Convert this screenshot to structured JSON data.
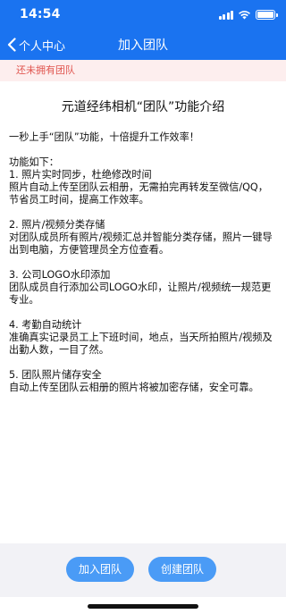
{
  "status_bar": {
    "time": "14:54"
  },
  "nav": {
    "back_label": "个人中心",
    "title": "加入团队"
  },
  "notice": {
    "text": "还未拥有团队"
  },
  "intro": {
    "title": "元道经纬相机“团队”功能介绍",
    "lead": "一秒上手“团队”功能，十倍提升工作效率！",
    "features_heading": "功能如下：",
    "features": [
      {
        "title": "1. 照片实时同步，杜绝修改时间",
        "desc": "照片自动上传至团队云相册，无需拍完再转发至微信/QQ，节省员工时间，提高工作效率。"
      },
      {
        "title": "2. 照片/视频分类存储",
        "desc": "对团队成员所有照片/视频汇总并智能分类存储，照片一键导出到电脑，方便管理员全方位查看。"
      },
      {
        "title": "3. 公司LOGO水印添加",
        "desc": "团队成员自行添加公司LOGO水印，让照片/视频统一规范更专业。"
      },
      {
        "title": "4. 考勤自动统计",
        "desc": "准确真实记录员工上下班时间，地点，当天所拍照片/视频及出勤人数，一目了然。"
      },
      {
        "title": "5. 团队照片储存安全",
        "desc": "自动上传至团队云相册的照片将被加密存储，安全可靠。"
      }
    ]
  },
  "footer": {
    "join_label": "加入团队",
    "create_label": "创建团队"
  },
  "colors": {
    "header_bg": "#1a73f0",
    "notice_bg": "#fdeeee",
    "notice_text": "#e0554f",
    "button_bg": "#4a9bf6",
    "footer_bg": "#f2f2f6"
  },
  "icons": {
    "back": "chevron-left-icon",
    "signal": "cellular-signal-icon",
    "wifi": "wifi-icon",
    "battery": "battery-icon"
  }
}
